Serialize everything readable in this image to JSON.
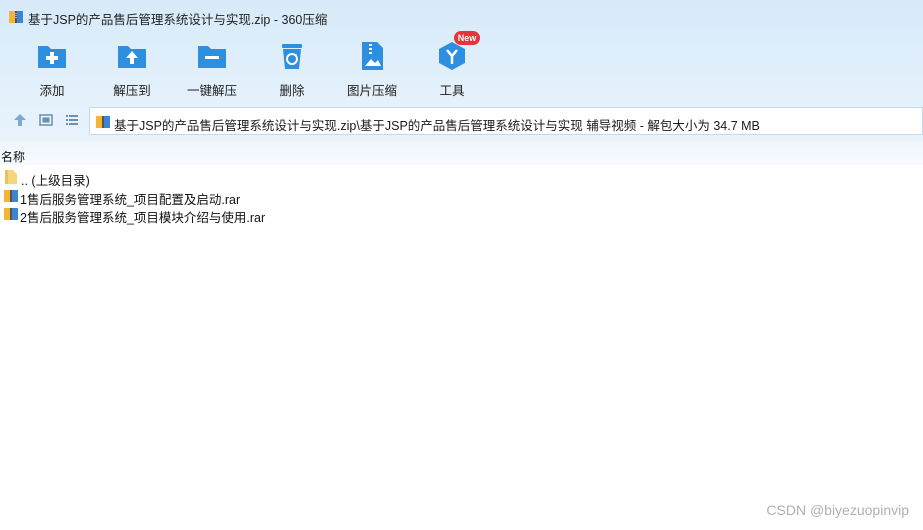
{
  "window": {
    "title": "基于JSP的产品售后管理系统设计与实现.zip - 360压缩"
  },
  "toolbar": {
    "buttons": [
      {
        "label": "添加",
        "icon": "add-folder-icon"
      },
      {
        "label": "解压到",
        "icon": "extract-folder-icon"
      },
      {
        "label": "一键解压",
        "icon": "one-click-extract-icon"
      },
      {
        "label": "删除",
        "icon": "recycle-bin-icon"
      },
      {
        "label": "图片压缩",
        "icon": "image-compress-icon"
      },
      {
        "label": "工具",
        "icon": "tools-cube-icon"
      }
    ],
    "new_badge": "New"
  },
  "nav": {
    "icons": [
      "up-arrow-icon",
      "thumbnail-view-icon",
      "list-view-icon"
    ],
    "path": "基于JSP的产品售后管理系统设计与实现.zip\\基于JSP的产品售后管理系统设计与实现 辅导视频 - 解包大小为 34.7 MB"
  },
  "list": {
    "column_name": "名称",
    "items": [
      {
        "name": ".. (上级目录)",
        "type": "folder"
      },
      {
        "name": "1售后服务管理系统_项目配置及启动.rar",
        "type": "archive"
      },
      {
        "name": "2售后服务管理系统_项目模块介绍与使用.rar",
        "type": "archive"
      }
    ]
  },
  "watermark": "CSDN @biyezuopinvip",
  "colors": {
    "accent": "#2d8fe0",
    "toolbar_bg": "#dcecfa",
    "badge": "#e8333a"
  }
}
